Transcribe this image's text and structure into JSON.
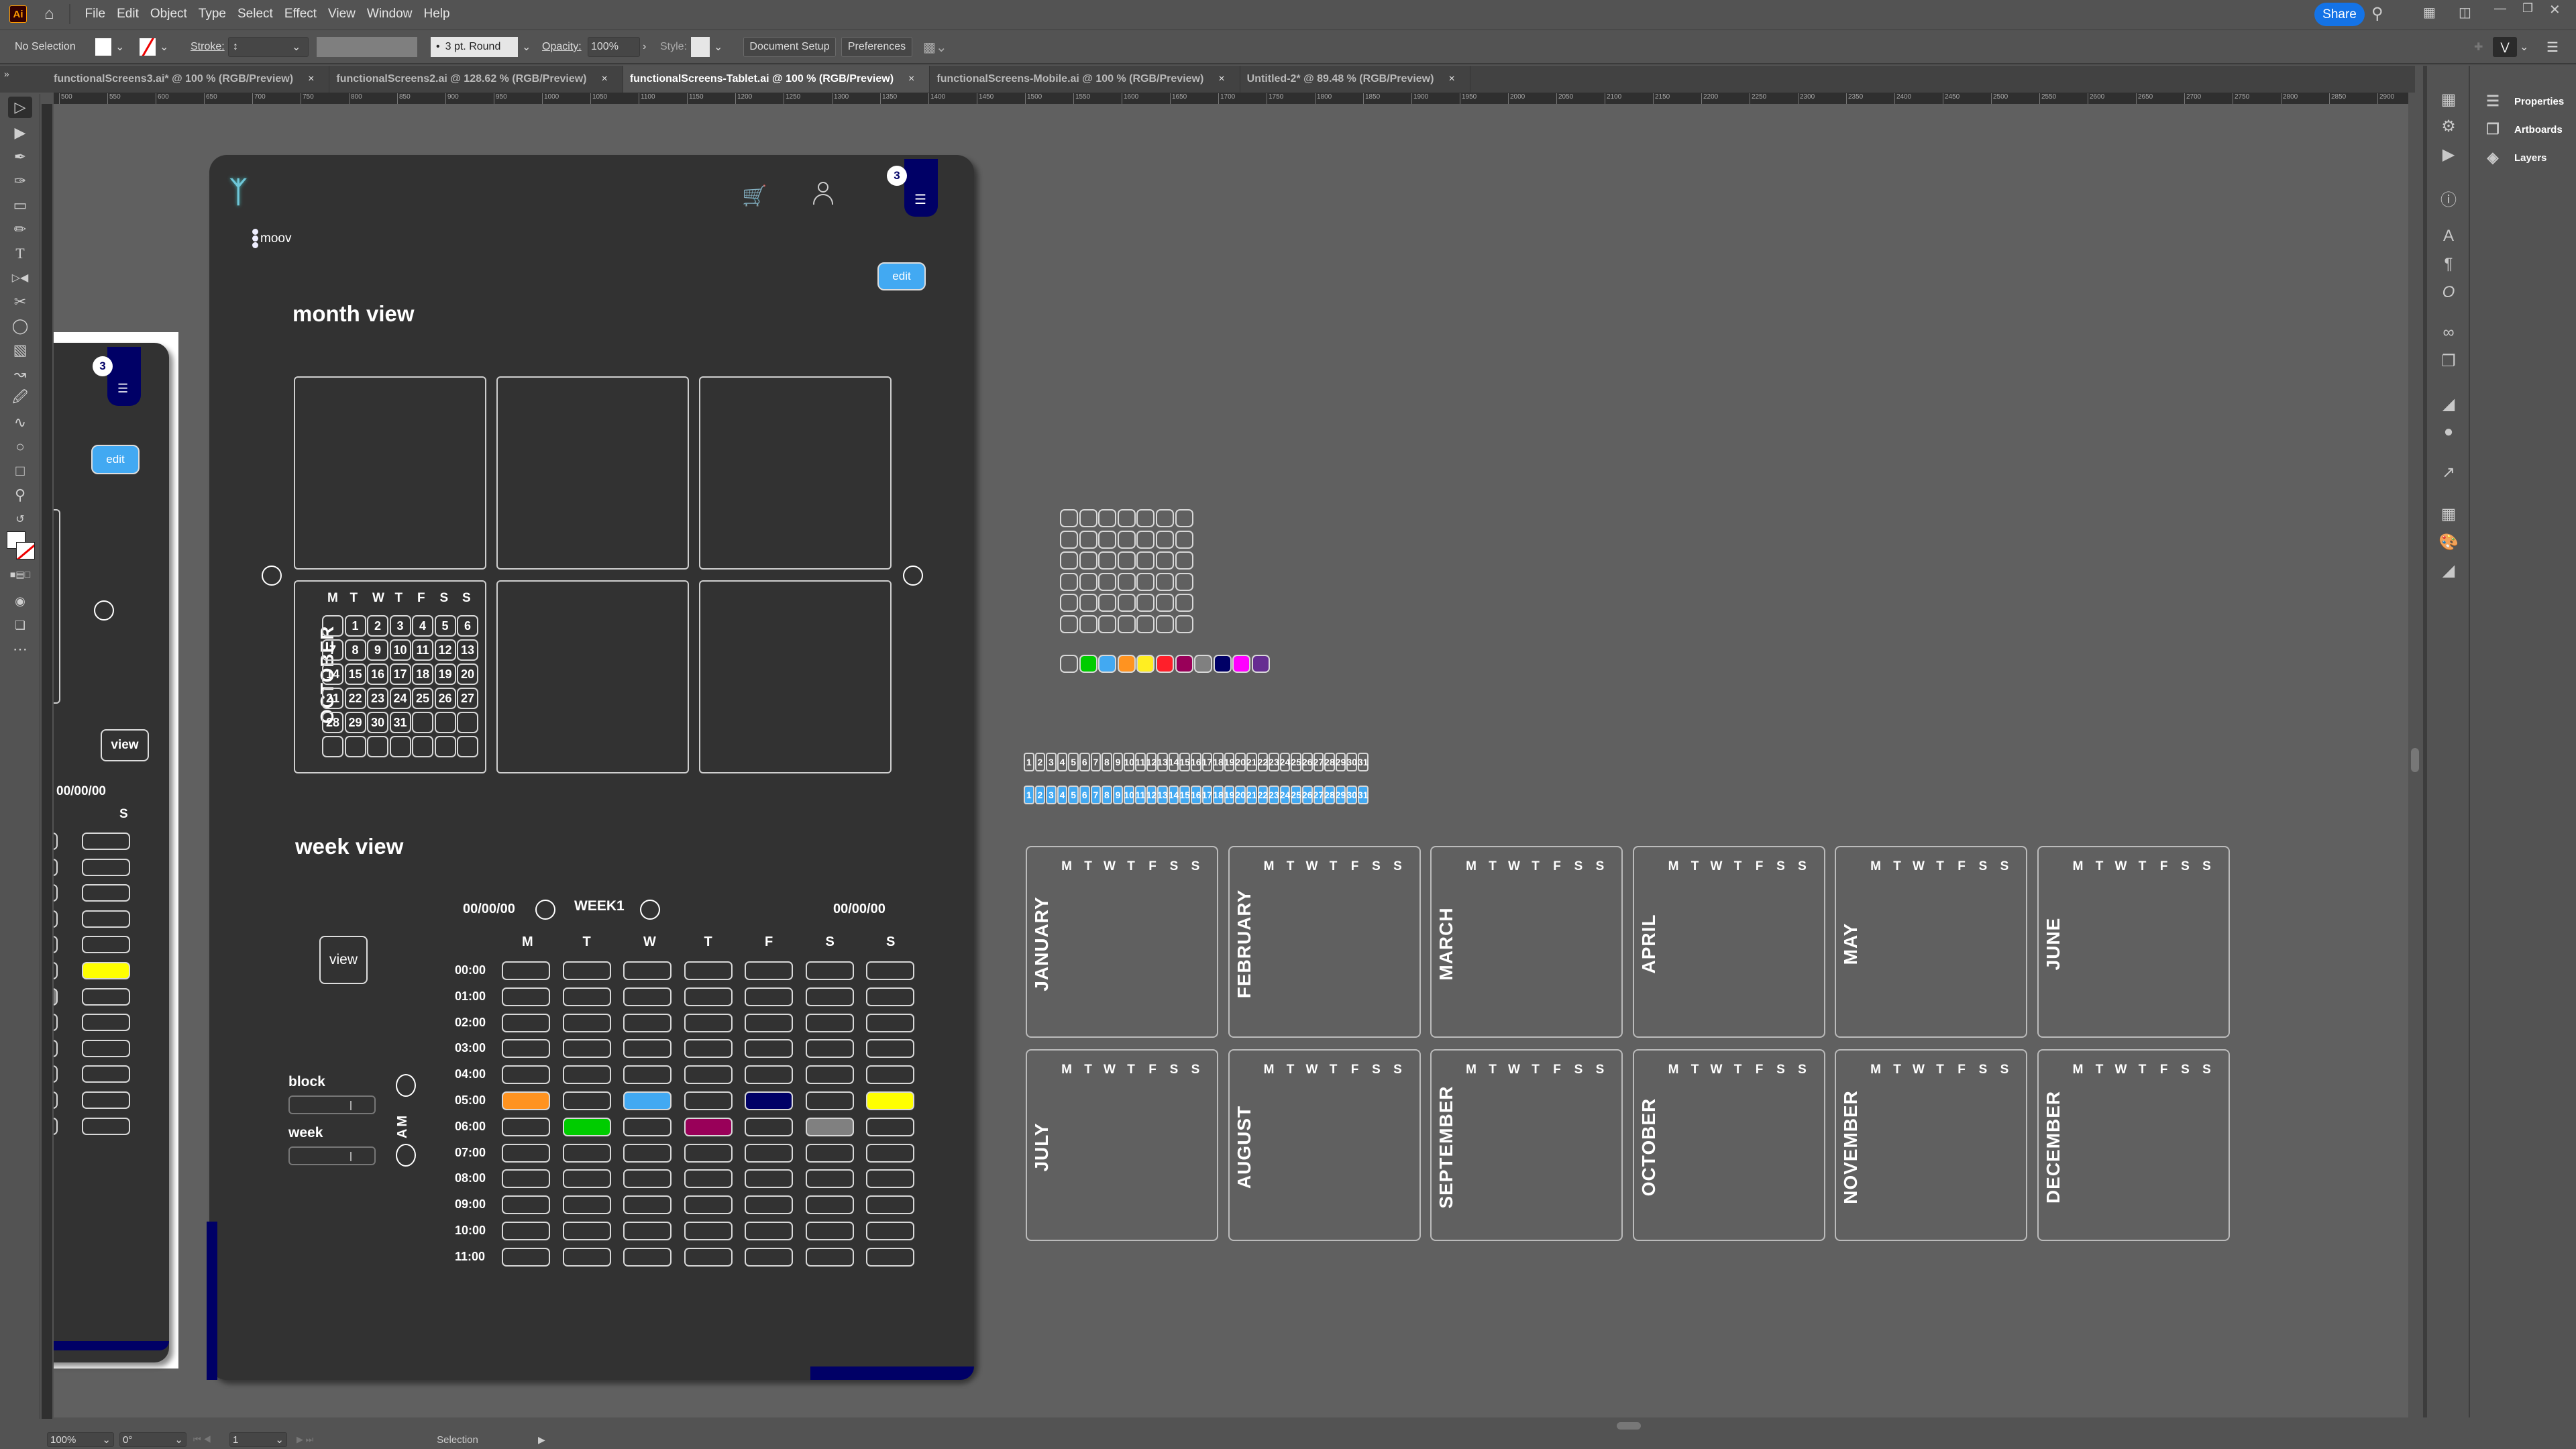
{
  "app": {
    "logo": "Ai",
    "menu": [
      "File",
      "Edit",
      "Object",
      "Type",
      "Select",
      "Effect",
      "View",
      "Window",
      "Help"
    ],
    "share_label": "Share"
  },
  "control_bar": {
    "selection": "No Selection",
    "stroke_label": "Stroke:",
    "brush": "3 pt. Round",
    "opacity_label": "Opacity:",
    "opacity_value": "100%",
    "style_label": "Style:",
    "document_setup": "Document Setup",
    "preferences": "Preferences"
  },
  "tabs": [
    {
      "label": "functionalScreens3.ai* @ 100 % (RGB/Preview)",
      "active": false
    },
    {
      "label": "functionalScreens2.ai @ 128.62 % (RGB/Preview)",
      "active": false
    },
    {
      "label": "functionalScreens-Tablet.ai @ 100 % (RGB/Preview)",
      "active": true
    },
    {
      "label": "functionalScreens-Mobile.ai @ 100 % (RGB/Preview)",
      "active": false
    },
    {
      "label": "Untitled-2* @ 89.48 % (RGB/Preview)",
      "active": false
    }
  ],
  "ruler_labels": [
    "500",
    "550",
    "600",
    "650",
    "700",
    "750",
    "800",
    "850",
    "900",
    "950",
    "1000",
    "1050",
    "1100",
    "1150",
    "1200",
    "1250",
    "1300",
    "1350",
    "1400",
    "1450",
    "1500",
    "1550",
    "1600",
    "1650",
    "1700",
    "1750",
    "1800",
    "1850",
    "1900",
    "1950",
    "2000",
    "2050",
    "2100",
    "2150",
    "2200",
    "2250",
    "2300",
    "2350",
    "2400",
    "2450",
    "2500",
    "2550",
    "2600",
    "2650",
    "2700",
    "2750",
    "2800",
    "2850",
    "2900"
  ],
  "right_panel": {
    "items": [
      {
        "label": "Properties",
        "icon": "sliders-icon"
      },
      {
        "label": "Artboards",
        "icon": "artboards-icon"
      },
      {
        "label": "Layers",
        "icon": "layers-icon"
      }
    ]
  },
  "status_bar": {
    "zoom": "100%",
    "rotation": "0°",
    "artboard": "1",
    "tool": "Selection"
  },
  "tablet": {
    "brand": "moov",
    "badge_count": "3",
    "edit_label": "edit",
    "month_view_title": "month view",
    "week_view_title": "week view",
    "view_label": "view",
    "month_calendar": {
      "month": "OCTOBER",
      "weekdays": [
        "M",
        "T",
        "W",
        "T",
        "F",
        "S",
        "S"
      ],
      "weeks": [
        [
          "",
          "1",
          "2",
          "3",
          "4",
          "5",
          "6"
        ],
        [
          "7",
          "8",
          "9",
          "10",
          "11",
          "12",
          "13"
        ],
        [
          "14",
          "15",
          "16",
          "17",
          "18",
          "19",
          "20"
        ],
        [
          "21",
          "22",
          "23",
          "24",
          "25",
          "26",
          "27"
        ],
        [
          "28",
          "29",
          "30",
          "31",
          "",
          "",
          ""
        ],
        [
          "",
          "",
          "",
          "",
          "",
          "",
          ""
        ]
      ]
    },
    "week": {
      "start_date": "00/00/00",
      "end_date": "00/00/00",
      "label": "WEEK1",
      "period": "AM",
      "days": [
        "M",
        "T",
        "W",
        "T",
        "F",
        "S",
        "S"
      ],
      "hours": [
        "00:00",
        "01:00",
        "02:00",
        "03:00",
        "04:00",
        "05:00",
        "06:00",
        "07:00",
        "08:00",
        "09:00",
        "10:00",
        "11:00"
      ],
      "filled": [
        {
          "hour": "05:00",
          "day": 0,
          "color": "#ff9320"
        },
        {
          "hour": "05:00",
          "day": 2,
          "color": "#42a9f2"
        },
        {
          "hour": "05:00",
          "day": 4,
          "color": "#000066"
        },
        {
          "hour": "05:00",
          "day": 6,
          "color": "#ffff00"
        },
        {
          "hour": "06:00",
          "day": 1,
          "color": "#00cc00"
        },
        {
          "hour": "06:00",
          "day": 3,
          "color": "#990059"
        },
        {
          "hour": "06:00",
          "day": 5,
          "color": "#808080"
        }
      ]
    },
    "block_label": "block",
    "week_label": "week"
  },
  "mobile": {
    "badge_count": "3",
    "edit_label": "edit",
    "view_label": "view",
    "date": "00/00/00",
    "day": "S"
  },
  "swatches": [
    "#606060",
    "#00cc00",
    "#42a9f2",
    "#ff9320",
    "#ffee22",
    "#ff1f2a",
    "#990059",
    "#808080",
    "#000066",
    "#ff00ff",
    "#662d91"
  ],
  "day_numbers": [
    "1",
    "2",
    "3",
    "4",
    "5",
    "6",
    "7",
    "8",
    "9",
    "10",
    "11",
    "12",
    "13",
    "14",
    "15",
    "16",
    "17",
    "18",
    "19",
    "20",
    "21",
    "22",
    "23",
    "24",
    "25",
    "26",
    "27",
    "28",
    "29",
    "30",
    "31"
  ],
  "accent": "#42a9f2",
  "months": [
    "JANUARY",
    "FEBRUARY",
    "MARCH",
    "APRIL",
    "MAY",
    "JUNE",
    "JULY",
    "AUGUST",
    "SEPTEMBER",
    "OCTOBER",
    "NOVEMBER",
    "DECEMBER"
  ],
  "month_weekdays": [
    "M",
    "T",
    "W",
    "T",
    "F",
    "S",
    "S"
  ]
}
